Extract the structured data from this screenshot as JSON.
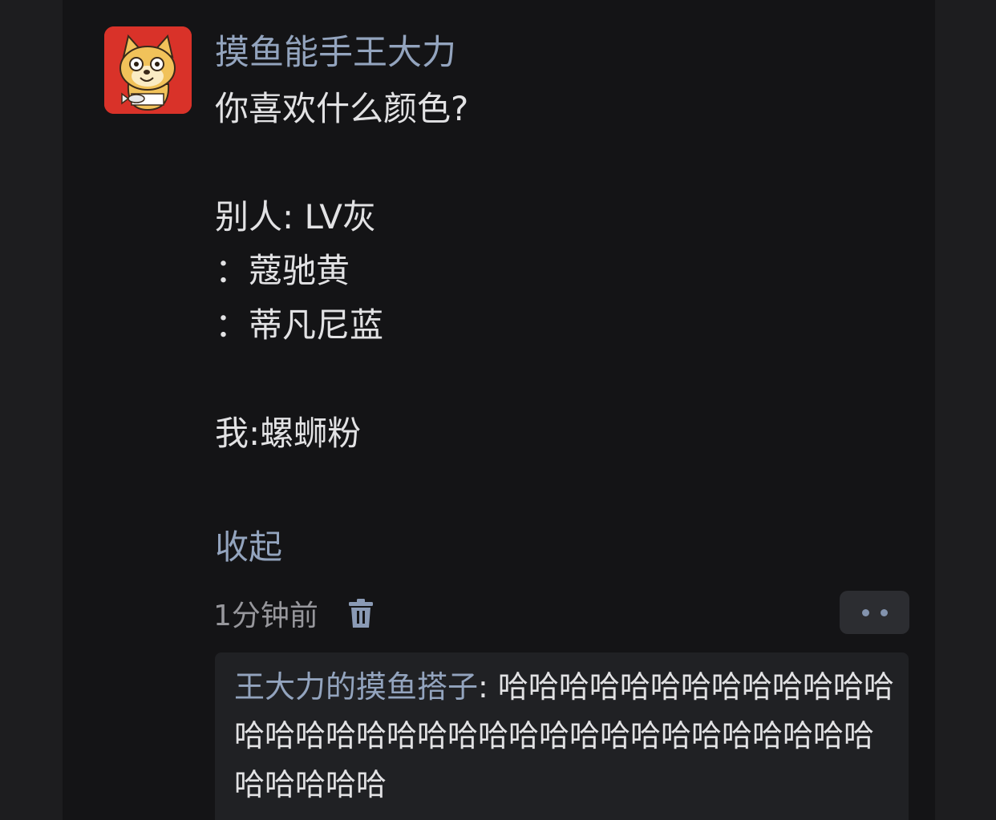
{
  "post": {
    "username": "摸鱼能手王大力",
    "lines": [
      "你喜欢什么颜色?",
      "别人: LV灰",
      "：蔻驰黄",
      "：蒂凡尼蓝",
      "我:螺蛳粉"
    ],
    "collapse_label": "收起",
    "timestamp": "1分钟前"
  },
  "reply": {
    "author": "王大力的摸鱼搭子",
    "separator": ": ",
    "text": "哈哈哈哈哈哈哈哈哈哈哈哈哈哈哈哈哈哈哈哈哈哈哈哈哈哈哈哈哈哈哈哈哈哈哈哈哈哈哈"
  },
  "icons": {
    "avatar": "cartoon-cat-avatar",
    "delete": "trash-icon",
    "more": "more-dots-icon"
  },
  "colors": {
    "background": "#141416",
    "accent": "#93a4be",
    "text": "#e2e2e4",
    "muted": "#97979c",
    "avatar_bg": "#d93229"
  }
}
